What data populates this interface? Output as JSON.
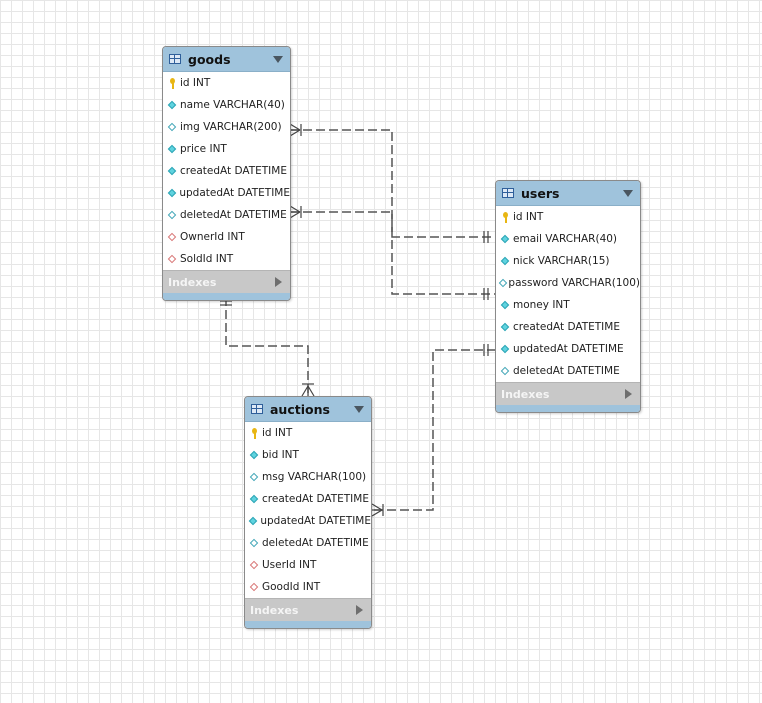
{
  "tables": {
    "goods": {
      "title": "goods",
      "columns": [
        {
          "label": "id INT",
          "icon": "primary-key-icon"
        },
        {
          "label": "name VARCHAR(40)",
          "icon": "column-filled-icon"
        },
        {
          "label": "img VARCHAR(200)",
          "icon": "column-hollow-icon"
        },
        {
          "label": "price INT",
          "icon": "column-filled-icon"
        },
        {
          "label": "createdAt DATETIME",
          "icon": "column-filled-icon"
        },
        {
          "label": "updatedAt DATETIME",
          "icon": "column-filled-icon"
        },
        {
          "label": "deletedAt DATETIME",
          "icon": "column-hollow-icon"
        },
        {
          "label": "OwnerId INT",
          "icon": "foreign-key-icon"
        },
        {
          "label": "SoldId INT",
          "icon": "foreign-key-icon"
        }
      ],
      "indexes_label": "Indexes"
    },
    "users": {
      "title": "users",
      "columns": [
        {
          "label": "id INT",
          "icon": "primary-key-icon"
        },
        {
          "label": "email VARCHAR(40)",
          "icon": "column-filled-icon"
        },
        {
          "label": "nick VARCHAR(15)",
          "icon": "column-filled-icon"
        },
        {
          "label": "password VARCHAR(100)",
          "icon": "column-hollow-icon"
        },
        {
          "label": "money INT",
          "icon": "column-filled-icon"
        },
        {
          "label": "createdAt DATETIME",
          "icon": "column-filled-icon"
        },
        {
          "label": "updatedAt DATETIME",
          "icon": "column-filled-icon"
        },
        {
          "label": "deletedAt DATETIME",
          "icon": "column-hollow-icon"
        }
      ],
      "indexes_label": "Indexes"
    },
    "auctions": {
      "title": "auctions",
      "columns": [
        {
          "label": "id INT",
          "icon": "primary-key-icon"
        },
        {
          "label": "bid INT",
          "icon": "column-filled-icon"
        },
        {
          "label": "msg VARCHAR(100)",
          "icon": "column-hollow-icon"
        },
        {
          "label": "createdAt DATETIME",
          "icon": "column-filled-icon"
        },
        {
          "label": "updatedAt DATETIME",
          "icon": "column-filled-icon"
        },
        {
          "label": "deletedAt DATETIME",
          "icon": "column-hollow-icon"
        },
        {
          "label": "UserId INT",
          "icon": "foreign-key-icon"
        },
        {
          "label": "GoodId INT",
          "icon": "foreign-key-icon"
        }
      ],
      "indexes_label": "Indexes"
    }
  },
  "relationships": [
    {
      "from": "users",
      "to": "goods",
      "via": "OwnerId",
      "from_end": "one-and-only-one",
      "to_end": "one-or-many"
    },
    {
      "from": "users",
      "to": "goods",
      "via": "SoldId",
      "from_end": "one-and-only-one",
      "to_end": "one-or-many"
    },
    {
      "from": "goods",
      "to": "auctions",
      "via": "GoodId",
      "from_end": "one-and-only-one",
      "to_end": "one-or-many"
    },
    {
      "from": "users",
      "to": "auctions",
      "via": "UserId",
      "from_end": "one-and-only-one",
      "to_end": "one-or-many"
    }
  ],
  "colors": {
    "header": "#9fc3dc",
    "indexes_bar": "#c8c8c8",
    "connector": "#555555",
    "primary_key": "#e8b613",
    "column_marker": "#5fd3df",
    "foreign_key_marker": "#d87575"
  }
}
